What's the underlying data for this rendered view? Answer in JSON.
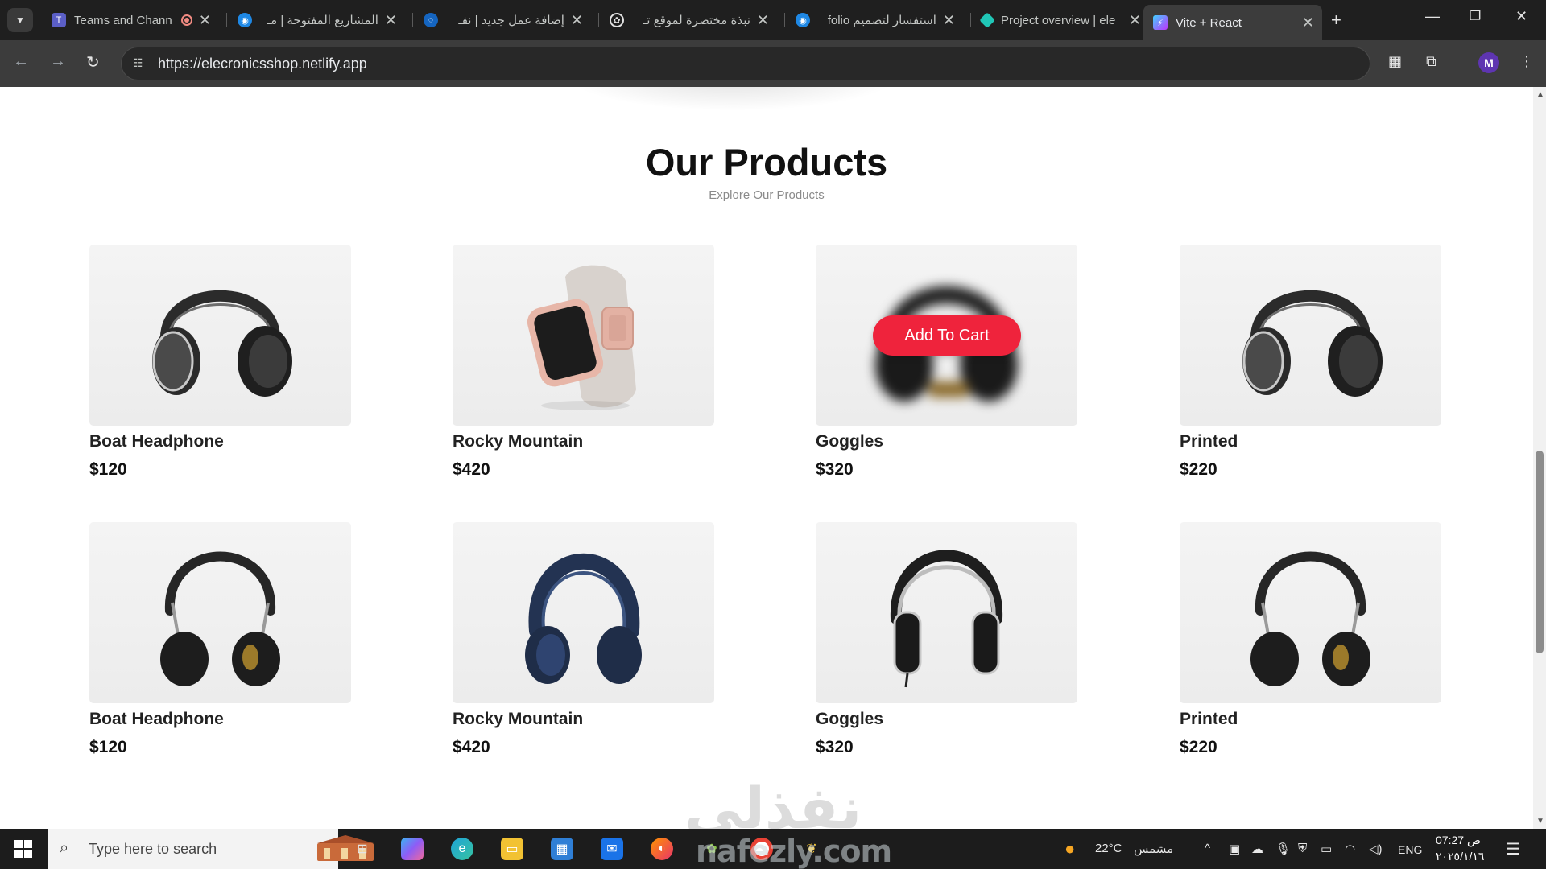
{
  "browser": {
    "tabs": [
      {
        "label": "Teams and Chann",
        "icon": "teams-icon",
        "active": false
      },
      {
        "label": "المشاريع المفتوحة | مـ",
        "icon": "nafezly-icon",
        "active": false
      },
      {
        "label": "إضافة عمل جديد | نفـ",
        "icon": "nafezly-icon",
        "active": false
      },
      {
        "label": "نبذة مختصرة لموقع تـ",
        "icon": "chatgpt-icon",
        "active": false
      },
      {
        "label": "استفسار لتصميم folio",
        "icon": "nafezly-icon",
        "active": false
      },
      {
        "label": "Project overview | ele",
        "icon": "netlify-icon",
        "active": false
      },
      {
        "label": "Vite + React",
        "icon": "vite-icon",
        "active": true
      }
    ],
    "url": "https://elecronicsshop.netlify.app",
    "profile_initial": "M"
  },
  "page": {
    "title": "Our Products",
    "subtitle": "Explore Our Products",
    "add_to_cart_label": "Add To Cart",
    "products": [
      {
        "name": "Boat Headphone",
        "price": "$120",
        "image": "over-ear-headphone-black"
      },
      {
        "name": "Rocky Mountain",
        "price": "$420",
        "image": "smartwatch-rose-gold"
      },
      {
        "name": "Goggles",
        "price": "$320",
        "image": "headphone-black-gold",
        "hovered": true
      },
      {
        "name": "Printed",
        "price": "$220",
        "image": "over-ear-headphone-black"
      },
      {
        "name": "Boat Headphone",
        "price": "$120",
        "image": "headphone-leather-black"
      },
      {
        "name": "Rocky Mountain",
        "price": "$420",
        "image": "headphone-navy-blue"
      },
      {
        "name": "Goggles",
        "price": "$320",
        "image": "headphone-silver-black"
      },
      {
        "name": "Printed",
        "price": "$220",
        "image": "headphone-leather-black"
      }
    ],
    "watermark": "نفذلي"
  },
  "taskbar": {
    "search_placeholder": "Type here to search",
    "weather": "22°C",
    "weather_desc": "مشمس",
    "language": "ENG",
    "time": "07:27 ص",
    "date": "٢٠٢٥/١/١٦",
    "watermark_text": "nafezly.com"
  }
}
